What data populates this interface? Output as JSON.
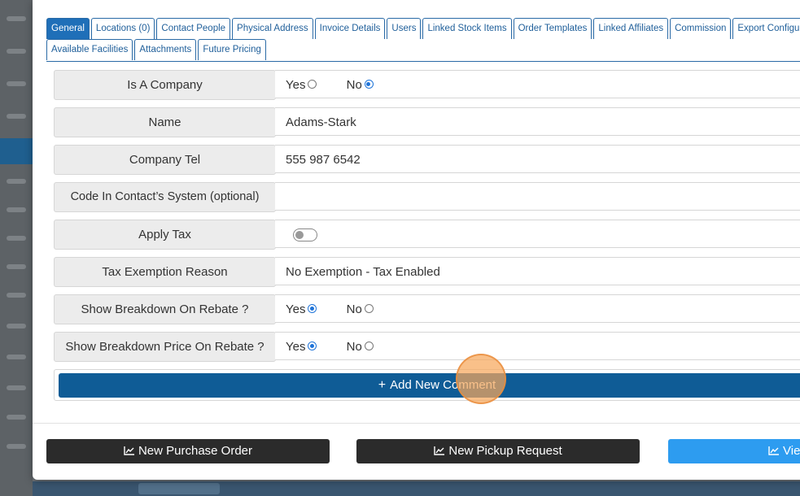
{
  "tabs_row1": [
    {
      "label": "General",
      "active": true
    },
    {
      "label": "Locations (0)"
    },
    {
      "label": "Contact People"
    },
    {
      "label": "Physical Address"
    },
    {
      "label": "Invoice Details"
    },
    {
      "label": "Users"
    },
    {
      "label": "Linked Stock Items"
    },
    {
      "label": "Order Templates"
    },
    {
      "label": "Linked Affiliates"
    },
    {
      "label": "Commission"
    },
    {
      "label": "Export Configura"
    }
  ],
  "tabs_row2": [
    {
      "label": "Available Facilities"
    },
    {
      "label": "Attachments"
    },
    {
      "label": "Future Pricing"
    }
  ],
  "form": {
    "is_company": {
      "label": "Is A Company",
      "yes": "Yes",
      "no": "No",
      "selected": "No"
    },
    "name": {
      "label": "Name",
      "value": "Adams-Stark"
    },
    "company_tel": {
      "label": "Company Tel",
      "value": "555 987 6542"
    },
    "code": {
      "label": "Code In Contact’s System (optional)",
      "value": ""
    },
    "apply_tax": {
      "label": "Apply Tax",
      "enabled": false
    },
    "tax_exemption": {
      "label": "Tax Exemption Reason",
      "value": "No Exemption - Tax Enabled"
    },
    "show_breakdown": {
      "label": "Show Breakdown On Rebate ?",
      "yes": "Yes",
      "no": "No",
      "selected": "Yes"
    },
    "show_breakdown_price": {
      "label": "Show Breakdown Price On Rebate ?",
      "yes": "Yes",
      "no": "No",
      "selected": "Yes"
    }
  },
  "add_comment": {
    "label": "Add New Comment",
    "icon": "plus-icon"
  },
  "footer": {
    "new_purchase_order": "New Purchase Order",
    "new_pickup_request": "New Pickup Request",
    "view": "Vie"
  },
  "colors": {
    "accent": "#0f5c96",
    "tab_active": "#1f6fb8",
    "radio": "#1e73d8",
    "blue_button": "#2d9cf0",
    "dark_button": "#2b2b2b"
  }
}
